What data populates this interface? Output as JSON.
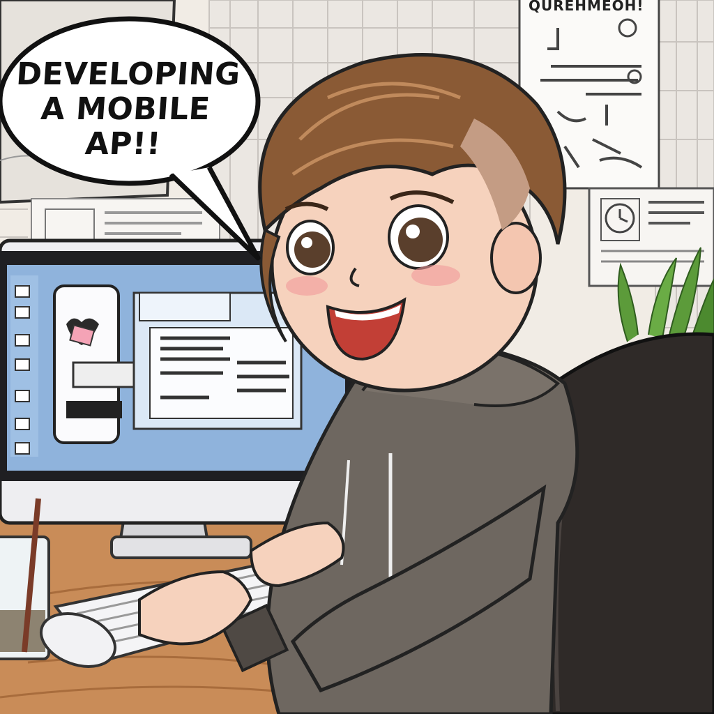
{
  "speech_bubble": {
    "text": "DEVELOPING A MOBILE AP!!"
  },
  "poster": {
    "header_text": "QUREHMEOH!"
  },
  "colors": {
    "wall": "#f3efe9",
    "hair": "#8a5a35",
    "skin": "#f6d2bd",
    "hoodie": "#6e6760",
    "chair": "#2f2a28",
    "desk": "#c98c58",
    "screen": "#8fb3dc",
    "plant": "#5c9b3a"
  },
  "icons": [
    "mouse-icon",
    "glass-icon",
    "plant-icon",
    "clock-icon"
  ]
}
